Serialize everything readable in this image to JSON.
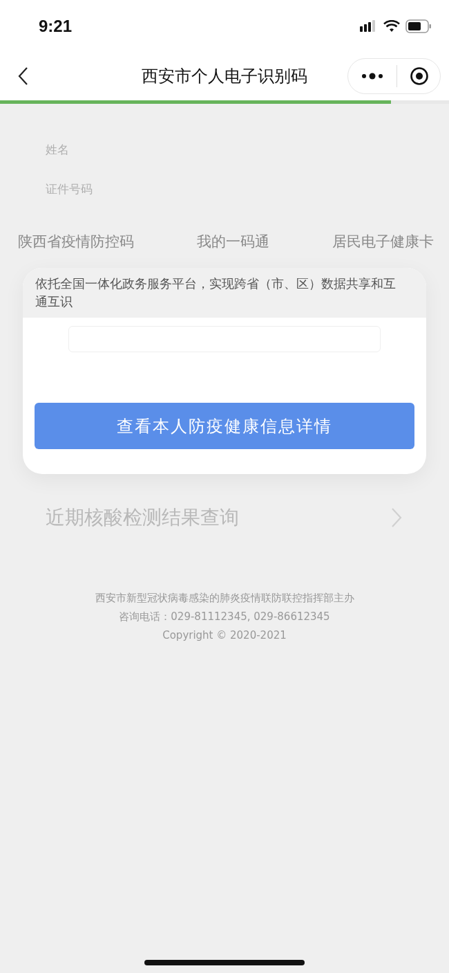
{
  "status_bar": {
    "time": "9:21"
  },
  "nav_bar": {
    "title": "西安市个人电子识别码",
    "loading": {
      "level": 0.87
    }
  },
  "user_info": [
    {
      "label": "姓名"
    },
    {
      "label": "证件号码"
    }
  ],
  "tabs": [
    "陕西省疫情防控码",
    "我的一码通",
    "居民电子健康卡"
  ],
  "card": {
    "notice": "依托全国一体化政务服务平台，实现跨省（市、区）数据共享和互通互识",
    "button": "查看本人防疫健康信息详情"
  },
  "nucleic_test_link": {
    "label": "近期核酸检测结果查询"
  },
  "footer": [
    "西安市新型冠状病毒感染的肺炎疫情联防联控指挥部主办",
    "咨询电话：029-81112345, 029-86612345",
    "Copyright © 2020-2021"
  ]
}
